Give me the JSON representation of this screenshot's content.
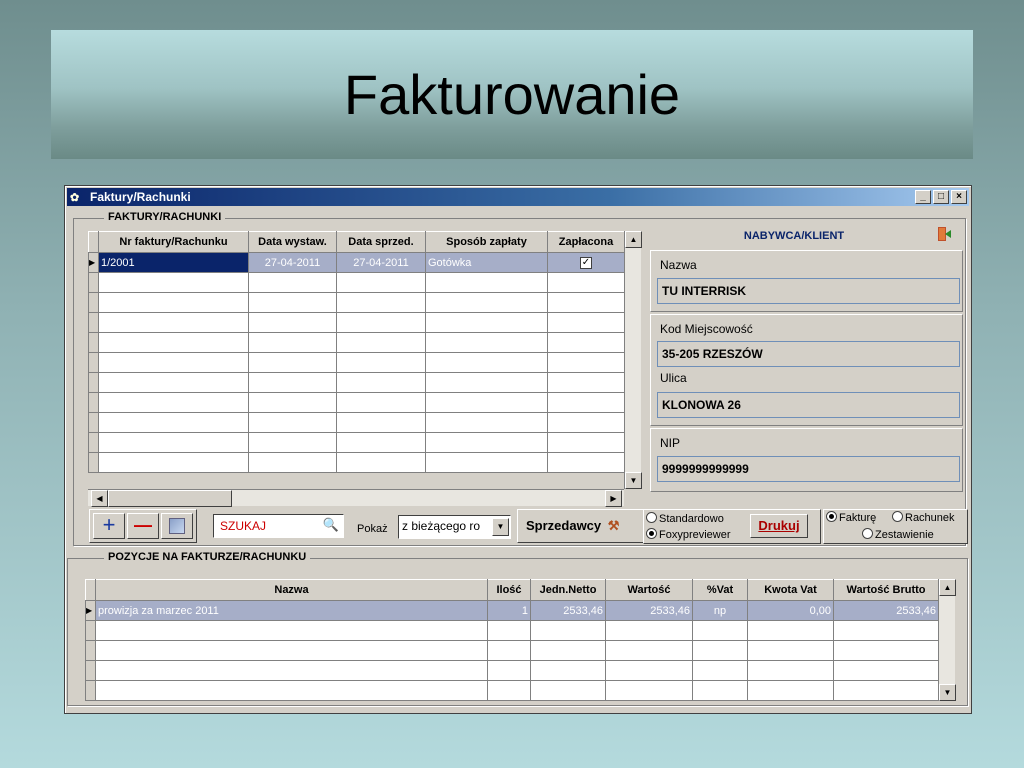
{
  "slide": {
    "title": "Fakturowanie"
  },
  "window": {
    "title": "Faktury/Rachunki",
    "minimize": "_",
    "maximize": "□",
    "close": "×"
  },
  "invoices": {
    "group_label": "FAKTURY/RACHUNKI",
    "columns": [
      "Nr faktury/Rachunku",
      "Data wystaw.",
      "Data sprzed.",
      "Sposób zapłaty",
      "Zapłacona"
    ],
    "rows": [
      {
        "nr": "1/2001",
        "data_wystaw": "27-04-2011",
        "data_sprzed": "27-04-2011",
        "sposob": "Gotówka",
        "zaplacona": true
      }
    ]
  },
  "client": {
    "title": "NABYWCA/KLIENT",
    "name_label": "Nazwa",
    "name_value": "TU INTERRISK",
    "city_label": "Kod Miejscowość",
    "city_value": "35-205 RZESZÓW",
    "street_label": "Ulica",
    "street_value": "KLONOWA 26",
    "nip_label": "NIP",
    "nip_value": "9999999999999"
  },
  "toolbar": {
    "add": "+",
    "remove": "—",
    "search_value": "SZUKAJ",
    "show_label": "Pokaż",
    "show_select": "z bieżącego ro",
    "sellers_label": "Sprzedawcy",
    "print_mode_standard": "Standardowo",
    "print_mode_foxy": "Foxypreviewer",
    "print_label": "Drukuj",
    "type_invoice": "Fakturę",
    "type_bill": "Rachunek",
    "type_summary": "Zestawienie"
  },
  "positions": {
    "group_label": "POZYCJE NA FAKTURZE/RACHUNKU",
    "columns": [
      "Nazwa",
      "Ilość",
      "Jedn.Netto",
      "Wartość",
      "%Vat",
      "Kwota Vat",
      "Wartość Brutto"
    ],
    "rows": [
      {
        "nazwa": "prowizja za marzec 2011",
        "ilosc": "1",
        "jedn_netto": "2533,46",
        "wartosc": "2533,46",
        "vat": "np",
        "kwota_vat": "0,00",
        "brutto": "2533,46"
      }
    ]
  },
  "colors": {
    "selection": "#0a246a",
    "client_title": "#0a246a",
    "search_text": "#cc0000",
    "print_text": "#aa0000"
  }
}
